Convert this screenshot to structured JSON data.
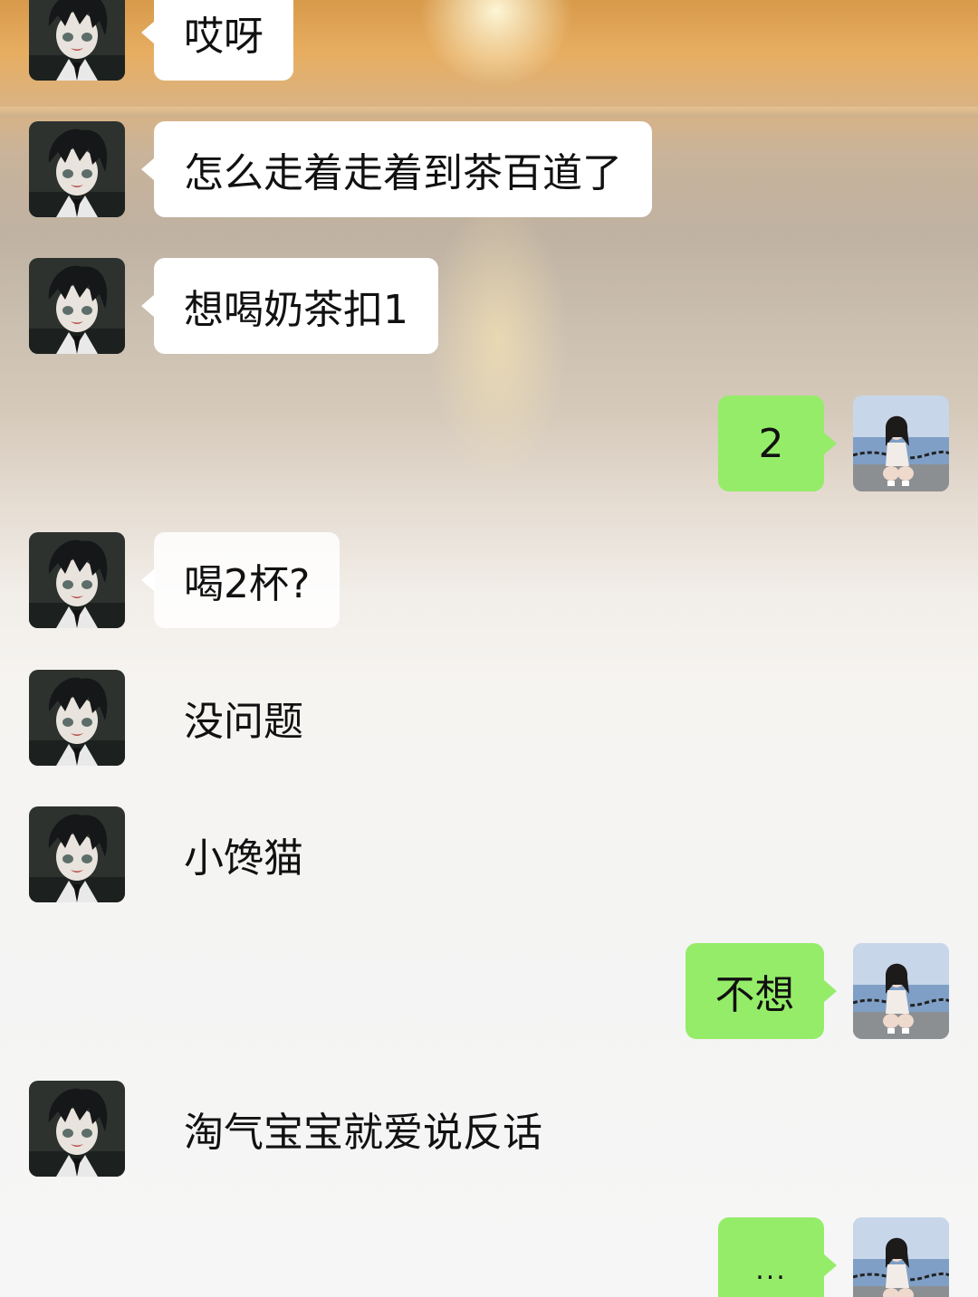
{
  "chat": {
    "messages": [
      {
        "side": "incoming",
        "text": "哎呀"
      },
      {
        "side": "incoming",
        "text": "怎么走着走着到茶百道了"
      },
      {
        "side": "incoming",
        "text": "想喝奶茶扣1"
      },
      {
        "side": "outgoing",
        "text": "2"
      },
      {
        "side": "incoming",
        "text": "喝2杯?"
      },
      {
        "side": "incoming",
        "text": "没问题"
      },
      {
        "side": "incoming",
        "text": "小馋猫"
      },
      {
        "side": "outgoing",
        "text": "不想"
      },
      {
        "side": "incoming",
        "text": "淘气宝宝就爱说反话"
      },
      {
        "side": "outgoing",
        "text": "..."
      }
    ]
  },
  "colors": {
    "outgoing_bubble": "#95ec69",
    "incoming_bubble": "#ffffff",
    "text": "#111111"
  },
  "avatars": {
    "contact": "anime-boy-avatar",
    "self": "girl-photo-avatar"
  }
}
